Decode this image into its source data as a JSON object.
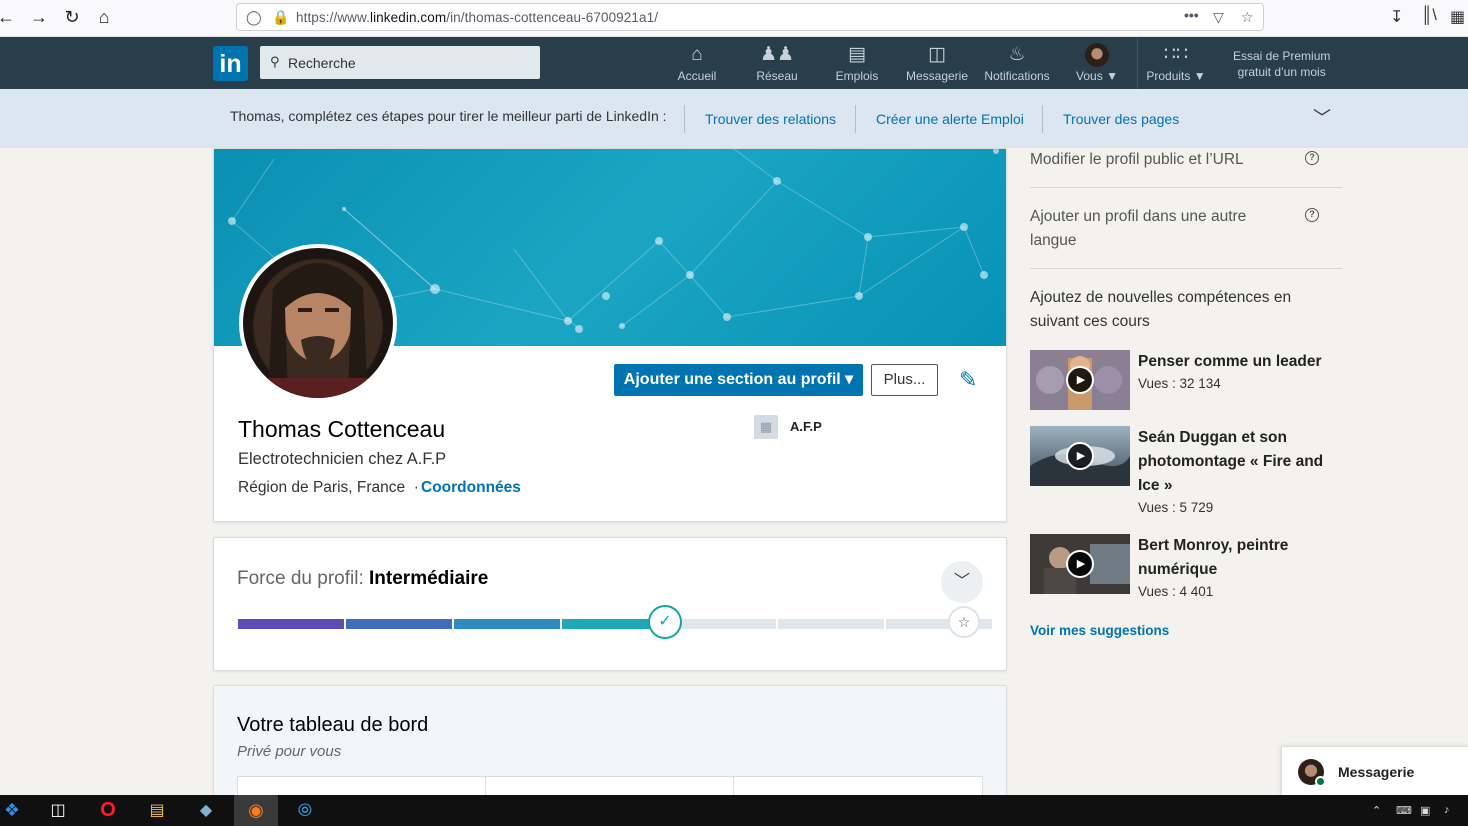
{
  "browser": {
    "url_prefix": "https://www.",
    "url_host": "linkedin.com",
    "url_path": "/in/thomas-cottenceau-6700921a1/"
  },
  "header": {
    "logo": "in",
    "search_placeholder": "Recherche",
    "nav": [
      {
        "label": "Accueil",
        "icon": "home-icon"
      },
      {
        "label": "Réseau",
        "icon": "people-icon"
      },
      {
        "label": "Emplois",
        "icon": "briefcase-icon"
      },
      {
        "label": "Messagerie",
        "icon": "chat-icon"
      },
      {
        "label": "Notifications",
        "icon": "bell-icon"
      },
      {
        "label": "Vous",
        "icon": "avatar"
      },
      {
        "label": "Produits",
        "icon": "grid-icon"
      }
    ],
    "premium_line1": "Essai de Premium",
    "premium_line2": "gratuit d’un mois"
  },
  "guide": {
    "text": "Thomas, complétez ces étapes pour tirer le meilleur parti de LinkedIn :",
    "links": [
      "Trouver des relations",
      "Créer une alerte Emploi",
      "Trouver des pages"
    ]
  },
  "profile": {
    "add_section_label": "Ajouter une section au profil",
    "more_label": "Plus...",
    "name": "Thomas Cottenceau",
    "headline": "Electrotechnicien chez A.F.P",
    "location": "Région de Paris, France",
    "separator": "·",
    "contact_label": "Coordonnées",
    "company": "A.F.P"
  },
  "strength": {
    "title_prefix": "Force du profil:",
    "level": "Intermédiaire",
    "completed_segments": 4,
    "total_segments": 7
  },
  "dashboard": {
    "title": "Votre tableau de bord",
    "subtitle": "Privé pour vous"
  },
  "sidebar": {
    "edit_public_profile": "Modifier le profil public et l’URL",
    "add_language_line1": "Ajouter un profil dans une autre",
    "add_language_line2": "langue",
    "courses_intro_line1": "Ajoutez de nouvelles compétences en",
    "courses_intro_line2": "suivant ces cours",
    "courses": [
      {
        "title_lines": [
          "Penser comme un leader"
        ],
        "views": "Vues : 32 134"
      },
      {
        "title_lines": [
          "Seán Duggan et son",
          "photomontage « Fire and",
          "Ice »"
        ],
        "views": "Vues : 5 729"
      },
      {
        "title_lines": [
          "Bert Monroy, peintre",
          "numérique"
        ],
        "views": "Vues : 4 401"
      }
    ],
    "see_suggestions": "Voir mes suggestions"
  },
  "messaging": {
    "label": "Messagerie"
  },
  "colors": {
    "linkedin_blue": "#0073b1",
    "header_bg": "#283e4a",
    "guide_bg": "#dce6f1"
  }
}
